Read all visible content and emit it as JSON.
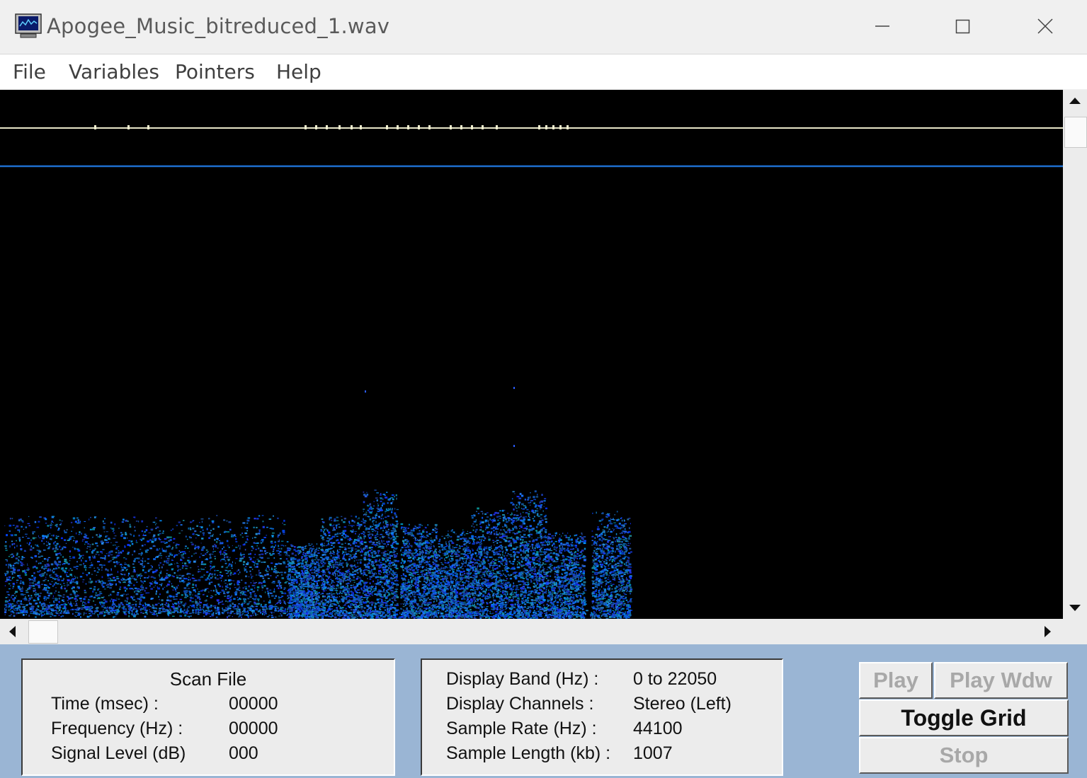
{
  "window": {
    "title": "Apogee_Music_bitreduced_1.wav",
    "icon": "monitor-app-icon"
  },
  "menu": {
    "items": [
      "File",
      "Variables",
      "Pointers",
      "Help"
    ]
  },
  "spectrogram": {
    "background": "#000000",
    "marker_line_color": "#e8e6c8",
    "cursor_line_color": "#1e6fd0",
    "spectrum_color": "#1a4dff"
  },
  "scan_panel": {
    "title": "Scan File",
    "time_label": "Time (msec) :",
    "time_value": "00000",
    "freq_label": "Frequency (Hz) :",
    "freq_value": "00000",
    "level_label": "Signal Level (dB)",
    "level_value": "000"
  },
  "info_panel": {
    "band_label": "Display Band (Hz) :",
    "band_value": "0 to 22050",
    "channels_label": "Display Channels :",
    "channels_value": "Stereo (Left)",
    "rate_label": "Sample Rate (Hz) :",
    "rate_value": "44100",
    "length_label": "Sample Length (kb) :",
    "length_value": "1007"
  },
  "buttons": {
    "play": "Play",
    "play_wdw": "Play Wdw",
    "toggle_grid": "Toggle Grid",
    "stop": "Stop"
  },
  "colors": {
    "panel_bg": "#9ab5d4",
    "disabled_text": "#a8a8a8"
  }
}
